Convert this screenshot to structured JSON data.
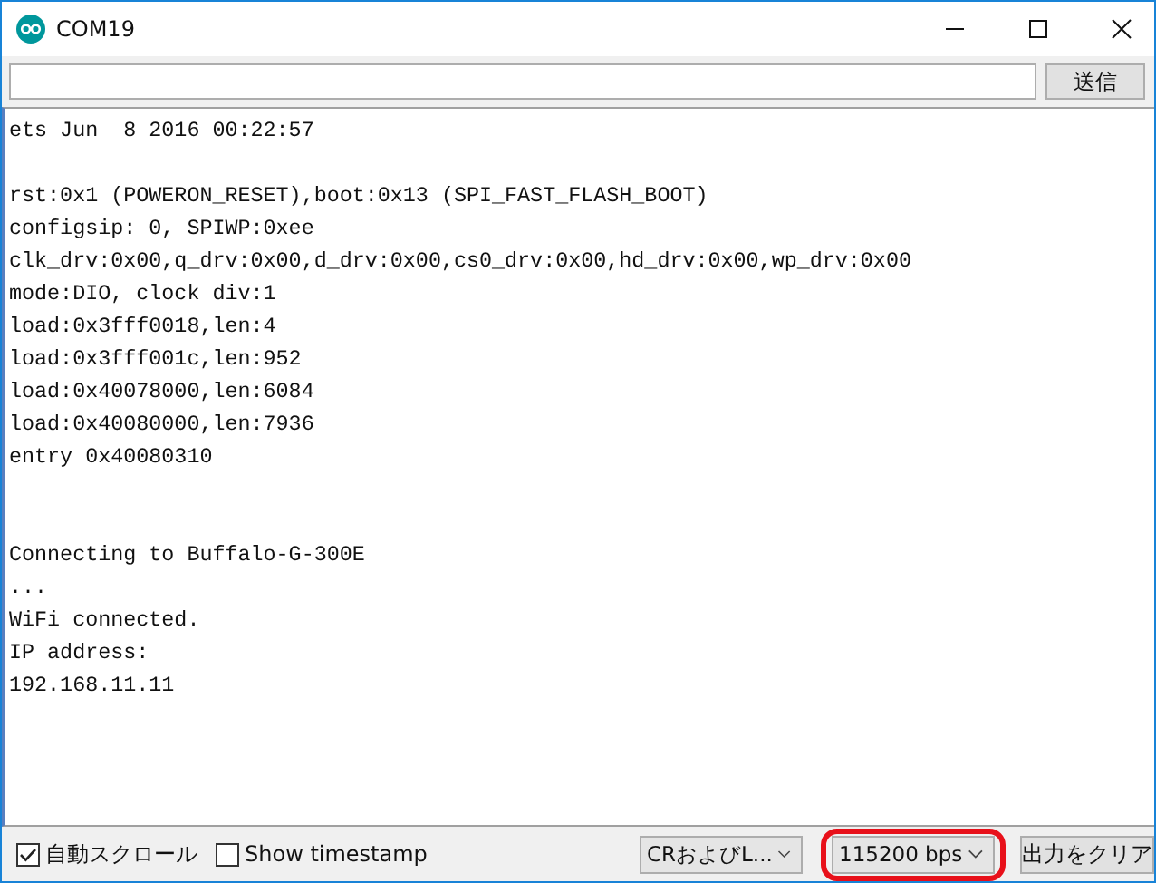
{
  "window": {
    "title": "COM19"
  },
  "send_bar": {
    "button": "送信"
  },
  "console": {
    "lines": [
      {
        "kind": "text",
        "text": "ets Jun  8 2016 00:22:57"
      },
      {
        "kind": "blank"
      },
      {
        "kind": "text",
        "text": "rst:0x1 (POWERON_RESET),boot:0x13 (SPI_FAST_FLASH_BOOT)"
      },
      {
        "kind": "text",
        "text": "configsip: 0, SPIWP:0xee"
      },
      {
        "kind": "text",
        "text": "clk_drv:0x00,q_drv:0x00,d_drv:0x00,cs0_drv:0x00,hd_drv:0x00,wp_drv:0x00"
      },
      {
        "kind": "text",
        "text": "mode:DIO, clock div:1"
      },
      {
        "kind": "text",
        "text": "load:0x3fff0018,len:4"
      },
      {
        "kind": "text",
        "text": "load:0x3fff001c,len:952"
      },
      {
        "kind": "text",
        "text": "load:0x40078000,len:6084"
      },
      {
        "kind": "text",
        "text": "load:0x40080000,len:7936"
      },
      {
        "kind": "text",
        "text": "entry 0x40080310"
      },
      {
        "kind": "blank"
      },
      {
        "kind": "blank"
      },
      {
        "kind": "text",
        "text": "Connecting to Buffalo-G-300E"
      },
      {
        "kind": "text",
        "text": "..."
      },
      {
        "kind": "text",
        "text": "WiFi connected."
      },
      {
        "kind": "text",
        "text": "IP address:"
      },
      {
        "kind": "text",
        "text": "192.168.11.11"
      }
    ]
  },
  "bottom_bar": {
    "checkboxes": [
      {
        "label": "自動スクロール",
        "checked": true
      },
      {
        "label": "Show timestamp",
        "checked": false
      }
    ],
    "dropdowns": [
      {
        "value": "CRおよびL...",
        "highlighted": false
      },
      {
        "value": "115200 bps",
        "highlighted": true
      }
    ],
    "button": "出力をクリア"
  }
}
